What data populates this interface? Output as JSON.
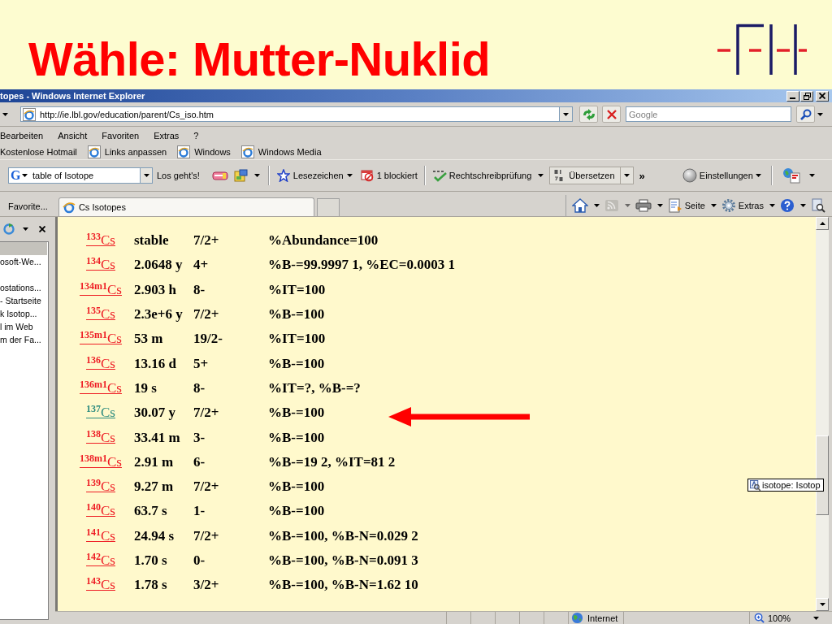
{
  "slide": {
    "title": "Wähle: Mutter-Nuklid"
  },
  "window": {
    "title": "topes - Windows Internet Explorer"
  },
  "address_bar": {
    "url": "http://ie.lbl.gov/education/parent/Cs_iso.htm",
    "search_placeholder": "Google"
  },
  "menu": [
    "Bearbeiten",
    "Ansicht",
    "Favoriten",
    "Extras",
    "?"
  ],
  "links_bar": [
    {
      "label": "Kostenlose Hotmail",
      "icon": false
    },
    {
      "label": "Links anpassen",
      "icon": true
    },
    {
      "label": "Windows",
      "icon": true
    },
    {
      "label": "Windows Media",
      "icon": true
    }
  ],
  "toolbar": {
    "engine": "G",
    "query": "table of Isotope",
    "go": "Los geht's!",
    "bookmarks": "Lesezeichen",
    "blocked": "1 blockiert",
    "spellcheck": "Rechtschreibprüfung",
    "translate": "Übersetzen",
    "more": "»",
    "settings": "Einstellungen"
  },
  "tab_bar": {
    "favorites": "Favorite...",
    "tabs": [
      {
        "label": "Cs Isotopes",
        "selected": true
      }
    ],
    "commands": [
      {
        "kind": "home",
        "disabled": false,
        "dropdown": true
      },
      {
        "kind": "feed",
        "disabled": true,
        "dropdown": true
      },
      {
        "kind": "print",
        "disabled": false,
        "dropdown": true
      },
      {
        "kind": "page",
        "label": "Seite",
        "disabled": false,
        "dropdown": true
      },
      {
        "kind": "tools",
        "label": "Extras",
        "disabled": false,
        "dropdown": true
      },
      {
        "kind": "help",
        "disabled": false,
        "dropdown": true
      },
      {
        "kind": "research",
        "disabled": false,
        "dropdown": false
      }
    ]
  },
  "sidebar": {
    "items": [
      "osoft-We...",
      "ostations...",
      "- Startseite",
      "k Isotop...",
      "l im Web",
      "m der Fa..."
    ]
  },
  "isotopes": [
    {
      "nuclide": "$^{133}$Cs",
      "visited": false,
      "half_life": "stable",
      "spin": "7/2+",
      "decay": "%Abundance=100"
    },
    {
      "nuclide": "$^{134}$Cs",
      "visited": false,
      "half_life": "2.0648 y",
      "spin": "4+",
      "decay": "%B-=99.9997 1, %EC=0.0003 1"
    },
    {
      "nuclide": "$^{134m1}$Cs",
      "visited": false,
      "half_life": "2.903 h",
      "spin": "8-",
      "decay": "%IT=100"
    },
    {
      "nuclide": "$^{135}$Cs",
      "visited": false,
      "half_life": "2.3e+6 y",
      "spin": "7/2+",
      "decay": "%B-=100"
    },
    {
      "nuclide": "$^{135m1}$Cs",
      "visited": false,
      "half_life": "53 m",
      "spin": "19/2-",
      "decay": "%IT=100"
    },
    {
      "nuclide": "$^{136}$Cs",
      "visited": false,
      "half_life": "13.16 d",
      "spin": "5+",
      "decay": "%B-=100"
    },
    {
      "nuclide": "$^{136m1}$Cs",
      "visited": false,
      "half_life": "19 s",
      "spin": "8-",
      "decay": "%IT=?, %B-=?"
    },
    {
      "nuclide": "$^{137}$Cs",
      "visited": true,
      "half_life": "30.07 y",
      "spin": "7/2+",
      "decay": "%B-=100"
    },
    {
      "nuclide": "$^{138}$Cs",
      "visited": false,
      "half_life": "33.41 m",
      "spin": "3-",
      "decay": "%B-=100"
    },
    {
      "nuclide": "$^{138m1}$Cs",
      "visited": false,
      "half_life": "2.91 m",
      "spin": "6-",
      "decay": "%B-=19 2, %IT=81 2"
    },
    {
      "nuclide": "$^{139}$Cs",
      "visited": false,
      "half_life": "9.27 m",
      "spin": "7/2+",
      "decay": "%B-=100"
    },
    {
      "nuclide": "$^{140}$Cs",
      "visited": false,
      "half_life": "63.7 s",
      "spin": "1-",
      "decay": "%B-=100"
    },
    {
      "nuclide": "$^{141}$Cs",
      "visited": false,
      "half_life": "24.94 s",
      "spin": "7/2+",
      "decay": "%B-=100, %B-N=0.029 2"
    },
    {
      "nuclide": "$^{142}$Cs",
      "visited": false,
      "half_life": "1.70 s",
      "spin": "0-",
      "decay": "%B-=100, %B-N=0.091 3"
    },
    {
      "nuclide": "$^{143}$Cs",
      "visited": false,
      "half_life": "1.78 s",
      "spin": "3/2+",
      "decay": "%B-=100, %B-N=1.62 10"
    }
  ],
  "tooltip": {
    "text": "isotope: Isotop"
  },
  "status_bar": {
    "zone": "Internet",
    "zoom": "100%"
  }
}
